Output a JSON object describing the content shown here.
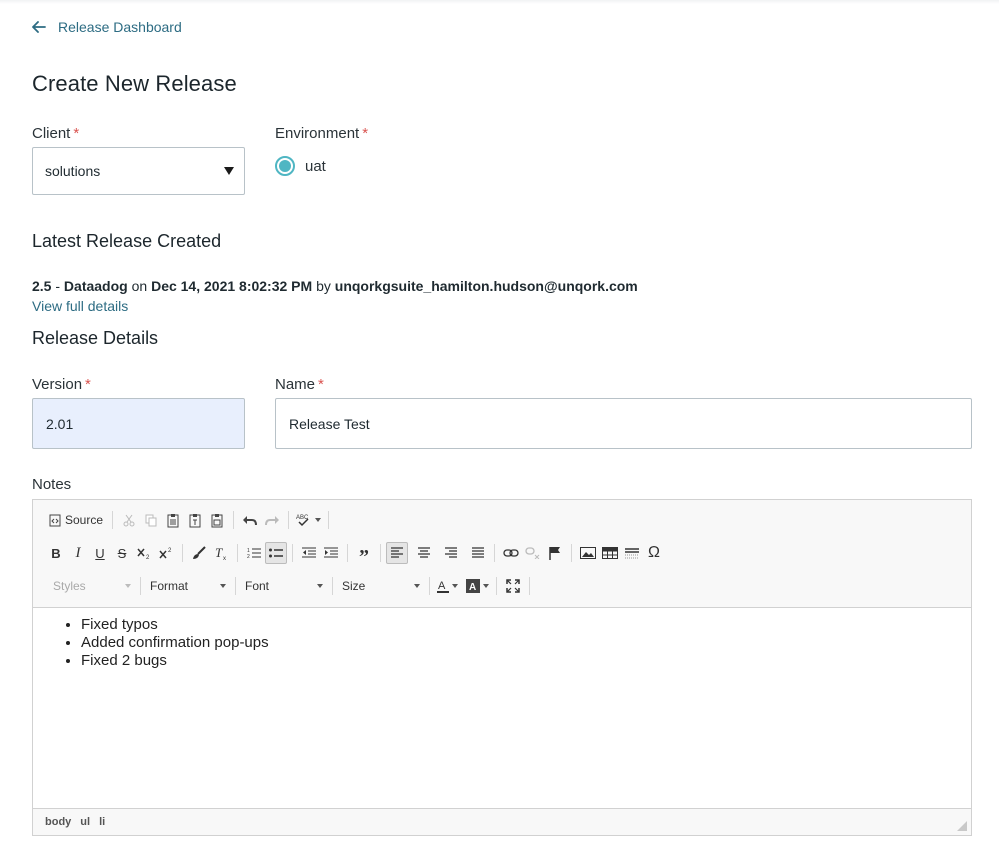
{
  "nav": {
    "back_label": "Release Dashboard"
  },
  "page": {
    "title": "Create New Release"
  },
  "client": {
    "label": "Client",
    "required_mark": "*",
    "value": "solutions"
  },
  "environment": {
    "label": "Environment",
    "required_mark": "*",
    "option": "uat",
    "selected": true
  },
  "latest": {
    "heading": "Latest Release Created",
    "version": "2.5",
    "sep": " - ",
    "name": "Dataadog",
    "on": " on ",
    "date": "Dec 14, 2021 8:02:32 PM",
    "by": " by ",
    "user": "unqorkgsuite_hamilton.hudson@unqork.com",
    "details_link": "View full details"
  },
  "details": {
    "heading": "Release Details",
    "version_label": "Version",
    "version_value": "2.01",
    "name_label": "Name",
    "name_value": "Release Test",
    "required_mark": "*"
  },
  "notes": {
    "label": "Notes",
    "toolbar": {
      "source": "Source",
      "styles": "Styles",
      "format": "Format",
      "font": "Font",
      "size": "Size",
      "bold": "B",
      "italic": "I",
      "underline": "U",
      "strike": "S",
      "omega": "Ω",
      "quote": "”"
    },
    "items": [
      "Fixed typos",
      "Added confirmation pop-ups",
      "Fixed 2 bugs"
    ],
    "path": [
      "body",
      "ul",
      "li"
    ]
  },
  "colors": {
    "accent": "#4fb6c3",
    "link": "#2d6c83",
    "required": "#d9534f",
    "version_bg": "#e8effd"
  }
}
